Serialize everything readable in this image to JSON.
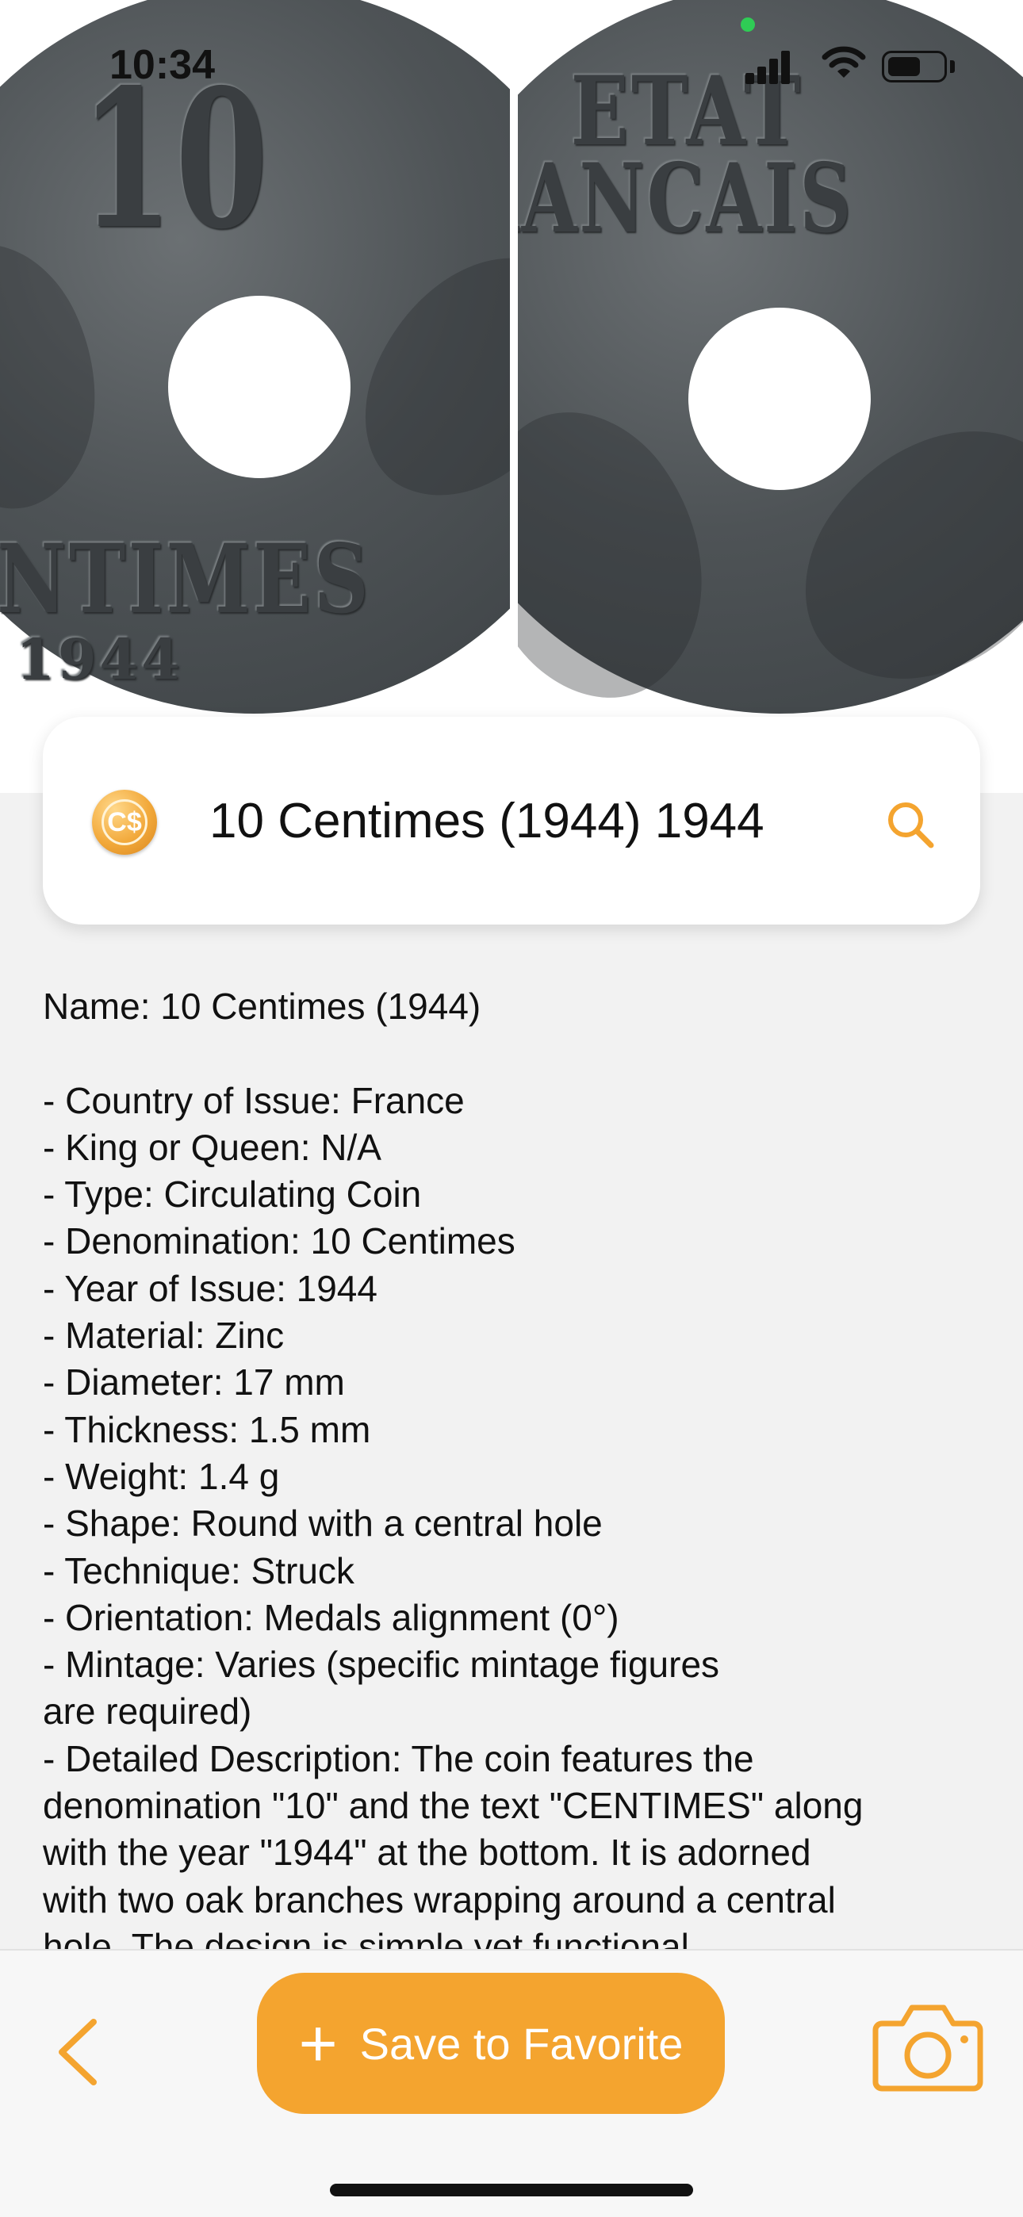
{
  "status_bar": {
    "time": "10:34"
  },
  "hero": {
    "obverse_text_value": "10",
    "obverse_text_centimes": "CENTIMES",
    "obverse_text_year": "1944",
    "reverse_text_line1": "ETAT",
    "reverse_text_line2": "FRANCAIS"
  },
  "title_card": {
    "title": "10 Centimes (1944) 1944",
    "badge_icon": "coin-dollar-icon",
    "badge_glyph": "C$",
    "search_icon": "search-icon"
  },
  "description": {
    "text": "Name: 10 Centimes (1944)\n\n- Country of Issue: France\n- King or Queen: N/A\n- Type: Circulating Coin\n- Denomination: 10 Centimes\n- Year of Issue: 1944\n- Material: Zinc\n- Diameter: 17 mm\n- Thickness: 1.5 mm\n- Weight: 1.4 g\n- Shape: Round with a central hole\n- Technique: Struck\n- Orientation: Medals alignment (0°)\n- Mintage: Varies (specific mintage figures\nare required)\n- Detailed Description: The coin features the\ndenomination \"10\" and the text \"CENTIMES\" along\nwith the year \"1944\" at the bottom. It is adorned\nwith two oak branches wrapping around a central\nhole. The design is simple yet functional."
  },
  "toolbar": {
    "back_icon": "chevron-left-icon",
    "save_label": "Save to Favorite",
    "save_plus": "+",
    "camera_icon": "camera-icon"
  },
  "colors": {
    "accent": "#f4a42f",
    "background": "#f2f2f2",
    "card": "#ffffff",
    "text": "#111111"
  }
}
